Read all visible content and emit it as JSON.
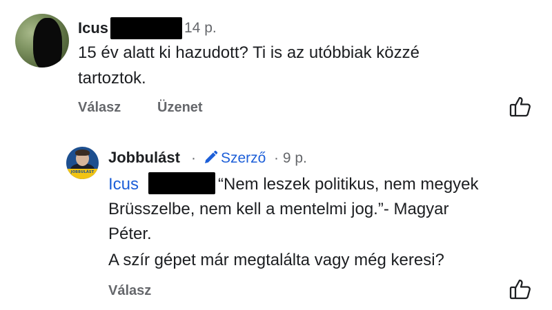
{
  "comment": {
    "author": "Icus",
    "time": "14 p.",
    "lines": [
      "15 év alatt ki hazudott?  Ti is az utóbbiak közzé",
      "tartoztok."
    ],
    "reply_label": "Válasz",
    "message_label": "Üzenet"
  },
  "reply": {
    "author": "Jobbulást",
    "separator": "·",
    "author_badge": "Szerző",
    "time": "· 9 p.",
    "avatar_text": "JOBBULÁST",
    "mention": "Icus",
    "lines": [
      "“Nem leszek politikus, nem megyek",
      "Brüsszelbe, nem kell a mentelmi jog.”- Magyar",
      "Péter.",
      "A szír gépet már megtalálta vagy még keresi?"
    ],
    "reply_label": "Válasz"
  },
  "colors": {
    "link": "#1d5fd8",
    "muted": "#65676b",
    "text": "#1c1e21"
  }
}
